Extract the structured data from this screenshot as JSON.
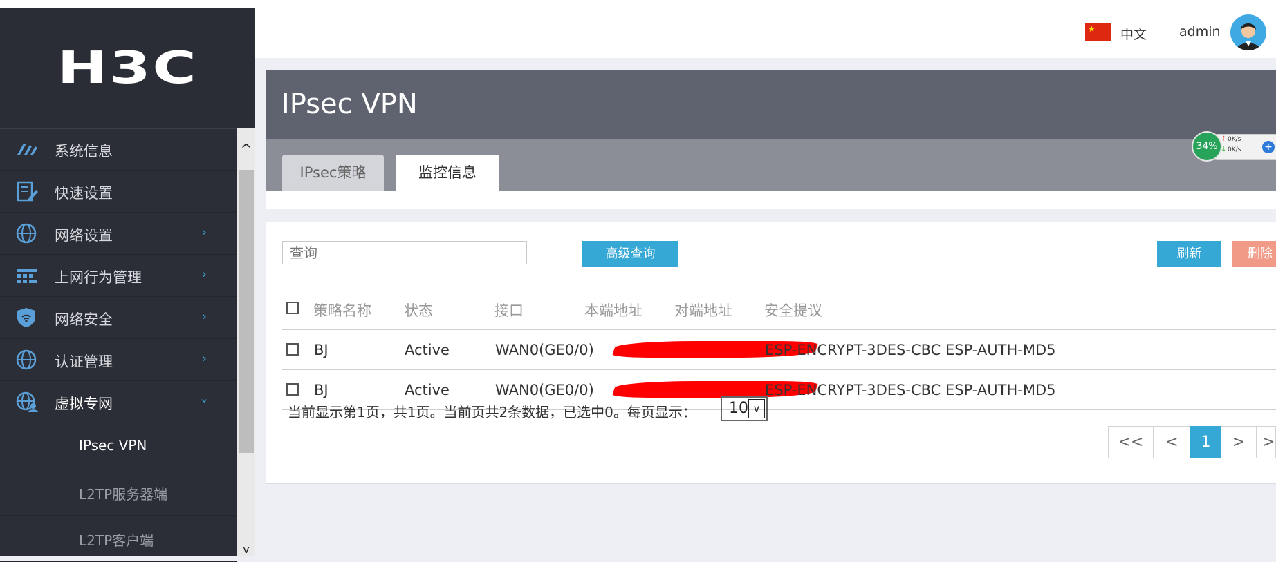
{
  "brand": {
    "logo_text": "H3C"
  },
  "header": {
    "language": "中文",
    "user": "admin"
  },
  "sidebar": {
    "items": [
      {
        "label": "系统信息",
        "icon": "dashboard-icon"
      },
      {
        "label": "快速设置",
        "icon": "quick-setup-icon"
      },
      {
        "label": "网络设置",
        "icon": "globe-icon"
      },
      {
        "label": "上网行为管理",
        "icon": "behavior-management-icon"
      },
      {
        "label": "网络安全",
        "icon": "shield-icon"
      },
      {
        "label": "认证管理",
        "icon": "globe-icon"
      },
      {
        "label": "虚拟专网",
        "icon": "vpn-globe-icon"
      }
    ],
    "sub_items": [
      {
        "label": "IPsec VPN"
      },
      {
        "label": "L2TP服务器端"
      },
      {
        "label": "L2TP客户端"
      }
    ],
    "scroll_up": "^",
    "scroll_down": "v"
  },
  "page": {
    "title": "IPsec VPN",
    "tabs": [
      {
        "label": "IPsec策略"
      },
      {
        "label": "监控信息"
      }
    ]
  },
  "toolbar": {
    "search_placeholder": "查询",
    "advanced_query": "高级查询",
    "refresh": "刷新",
    "delete": "删除"
  },
  "table": {
    "columns": [
      "策略名称",
      "状态",
      "接口",
      "本端地址",
      "对端地址",
      "安全提议"
    ],
    "rows": [
      {
        "name": "BJ",
        "status": "Active",
        "interface": "WAN0(GE0/0)",
        "proposal": "ESP-ENCRYPT-3DES-CBC ESP-AUTH-MD5"
      },
      {
        "name": "BJ",
        "status": "Active",
        "interface": "WAN0(GE0/0)",
        "proposal": "ESP-ENCRYPT-3DES-CBC ESP-AUTH-MD5"
      }
    ]
  },
  "pagination": {
    "summary": "当前显示第1页，共1页。当前页共2条数据，已选中0。每页显示：",
    "page_size": "10",
    "buttons": [
      "<<",
      "<",
      "1",
      ">",
      ">>"
    ]
  },
  "monitor": {
    "percent": "34%",
    "up_speed": "0K/s",
    "down_speed": "0K/s",
    "plus": "+"
  },
  "colors": {
    "sidebar_bg": "#2b2e36",
    "title_bg": "#5f626f",
    "tab_bar_bg": "#8b8d97",
    "accent": "#35a8d6",
    "delete": "#f29a88",
    "chevron": "#3aa8d8"
  }
}
